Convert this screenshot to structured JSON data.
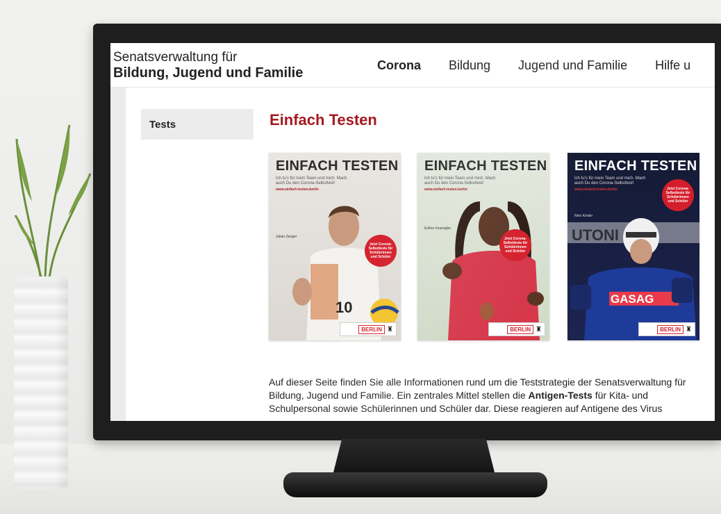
{
  "header": {
    "brand_line1": "Senatsverwaltung für",
    "brand_line2": "Bildung, Jugend und Familie",
    "nav": [
      {
        "label": "Corona",
        "active": true
      },
      {
        "label": "Bildung",
        "active": false
      },
      {
        "label": "Jugend und Familie",
        "active": false
      },
      {
        "label": "Hilfe u",
        "active": false
      }
    ]
  },
  "sidebar": {
    "items": [
      {
        "label": "Tests",
        "active": true
      }
    ]
  },
  "main": {
    "title": "Einfach Testen",
    "posters": [
      {
        "title": "EINFACH TESTEN",
        "sub": "Ich tu's für mein Team und mich. Mach auch Du den Corona-Selbsttest!",
        "url": "www.einfach-testen.berlin",
        "name": "Julian Zenger",
        "badge": "Jetzt Corona-Selbsttests für Schülerinnen und Schüler",
        "footer": "BERLIN"
      },
      {
        "title": "EINFACH TESTEN",
        "sub": "Ich tu's für mein Team und mich. Mach auch Du den Corona-Selbsttest!",
        "url": "www.einfach-testen.berlin",
        "name": "Esther Imariagbe",
        "badge": "Jetzt Corona-Selbsttests für Schülerinnen und Schüler",
        "footer": "BERLIN"
      },
      {
        "title": "EINFACH TESTEN",
        "sub": "Ich tu's für mein Team und mich. Mach auch Du den Corona-Selbsttest!",
        "url": "www.einfach-testen.berlin",
        "name": "Nino Kinder",
        "badge": "Jetzt Corona-Selbsttests für Schülerinnen und Schüler",
        "footer": "BERLIN"
      }
    ],
    "intro_part1": "Auf dieser Seite finden Sie alle Informationen rund um die Teststrategie der Senatsverwaltung für Bildung, Jugend und Familie. Ein zentrales Mittel stellen die ",
    "intro_bold": "Antigen-Tests",
    "intro_part2": " für Kita- und Schulpersonal sowie Schülerinnen und Schüler dar. Diese reagieren auf Antigene des Virus"
  },
  "colors": {
    "accent": "#a3191f",
    "badge": "#d41e2b"
  }
}
